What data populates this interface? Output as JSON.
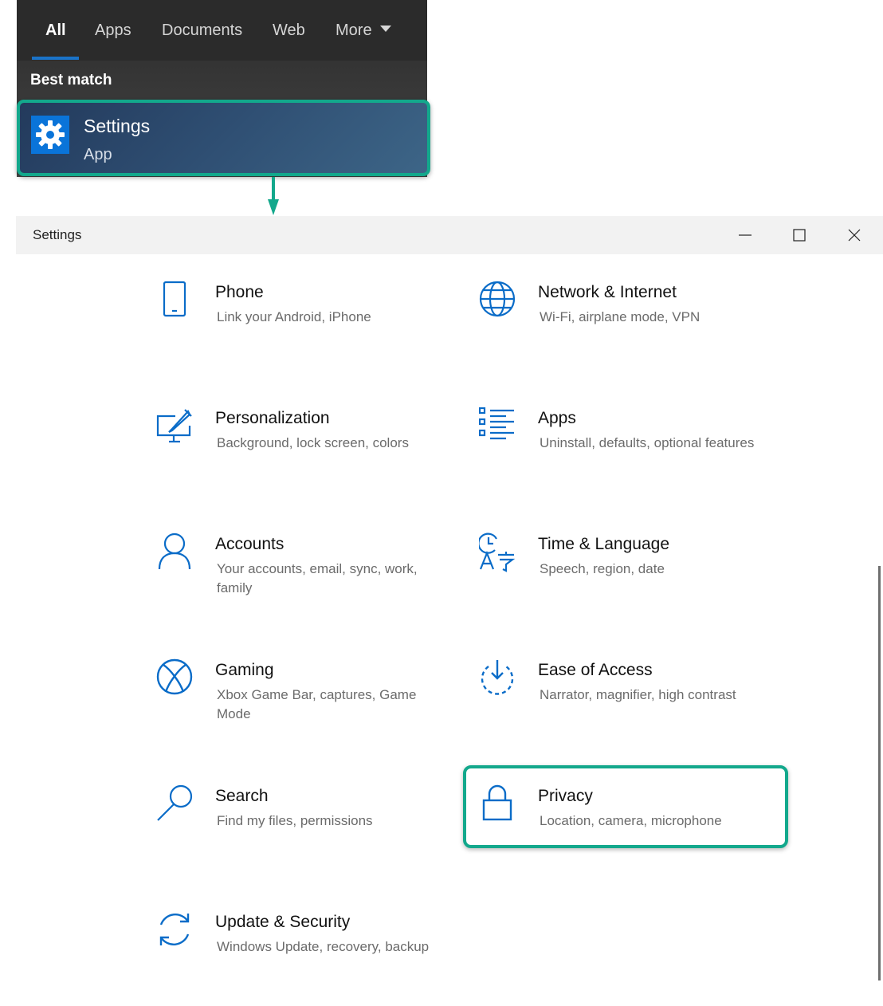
{
  "search": {
    "tabs": [
      {
        "label": "All"
      },
      {
        "label": "Apps"
      },
      {
        "label": "Documents"
      },
      {
        "label": "Web"
      },
      {
        "label": "More"
      }
    ],
    "best_match_label": "Best match",
    "result": {
      "name": "Settings",
      "type": "App",
      "icon": "gear-icon"
    }
  },
  "window": {
    "title": "Settings",
    "controls": [
      "minimize-icon",
      "maximize-icon",
      "close-icon"
    ]
  },
  "settings": {
    "items": [
      {
        "title": "Phone",
        "desc": "Link your Android, iPhone",
        "icon": "phone-icon"
      },
      {
        "title": "Network & Internet",
        "desc": "Wi-Fi, airplane mode, VPN",
        "icon": "globe-icon"
      },
      {
        "title": "Personalization",
        "desc": "Background, lock screen, colors",
        "icon": "personalization-icon"
      },
      {
        "title": "Apps",
        "desc": "Uninstall, defaults, optional features",
        "icon": "apps-list-icon"
      },
      {
        "title": "Accounts",
        "desc": "Your accounts, email, sync, work, family",
        "icon": "person-icon"
      },
      {
        "title": "Time & Language",
        "desc": "Speech, region, date",
        "icon": "time-language-icon"
      },
      {
        "title": "Gaming",
        "desc": "Xbox Game Bar, captures, Game Mode",
        "icon": "xbox-icon"
      },
      {
        "title": "Ease of Access",
        "desc": "Narrator, magnifier, high contrast",
        "icon": "ease-of-access-icon"
      },
      {
        "title": "Search",
        "desc": "Find my files, permissions",
        "icon": "search-icon"
      },
      {
        "title": "Privacy",
        "desc": "Location, camera, microphone",
        "icon": "lock-icon"
      },
      {
        "title": "Update & Security",
        "desc": "Windows Update, recovery, backup",
        "icon": "sync-icon"
      }
    ]
  },
  "colors": {
    "accent": "#0a74d9",
    "highlight": "#13a88c",
    "icon_blue": "#0a6cc8"
  }
}
